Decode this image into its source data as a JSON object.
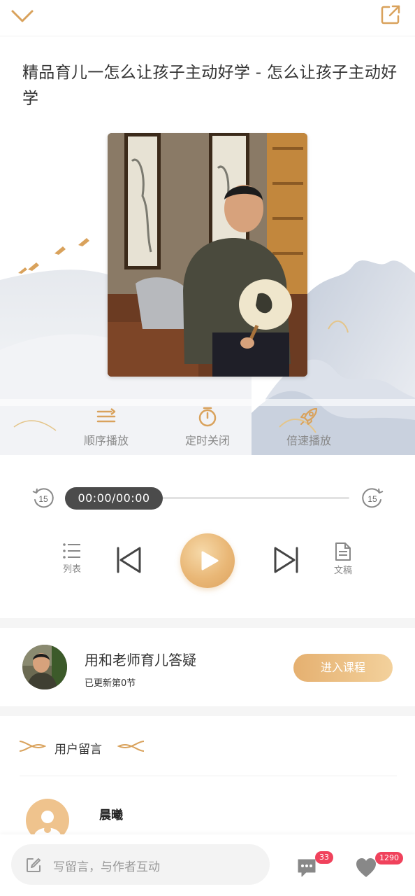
{
  "title": "精品育儿一怎么让孩子主动好学 - 怎么让孩子主动好学",
  "modes": [
    {
      "label": "顺序播放",
      "icon": "order-play-icon"
    },
    {
      "label": "定时关闭",
      "icon": "timer-icon"
    },
    {
      "label": "倍速播放",
      "icon": "speed-rocket-icon"
    }
  ],
  "player": {
    "time": "00:00/00:00",
    "skip_back_label": "15",
    "skip_forward_label": "15",
    "list_label": "列表",
    "doc_label": "文稿"
  },
  "course": {
    "name": "用和老师育儿答疑",
    "updated": "已更新第0节",
    "enter_label": "进入课程"
  },
  "comments": {
    "header": "用户留言",
    "first_user": "晨曦"
  },
  "bottom": {
    "input_placeholder": "写留言，与作者互动",
    "comment_count": "33",
    "like_count": "1290"
  },
  "colors": {
    "accent": "#d9a25c",
    "badge": "#f0425c",
    "time_pill": "#4b4b4b"
  }
}
